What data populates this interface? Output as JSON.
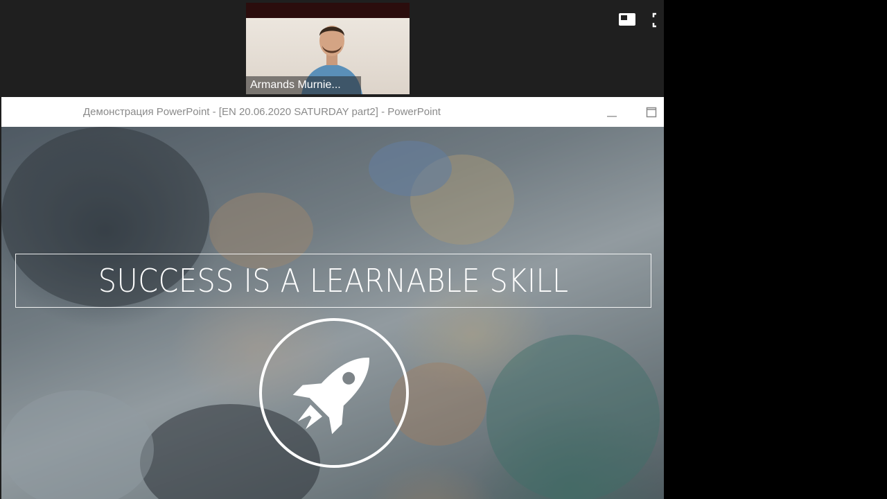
{
  "participant": {
    "name": "Armands Murnie..."
  },
  "window": {
    "title": "Демонстрация PowerPoint - [EN 20.06.2020 SATURDAY part2] - PowerPoint"
  },
  "slide": {
    "title": "SUCCESS IS A LEARNABLE SKILL",
    "emblem_icon": "rocket-icon"
  },
  "controls": {
    "layout_icon": "layout-icon",
    "fullscreen_icon": "fullscreen-icon",
    "minimize_icon": "minimize-icon",
    "maximize_icon": "maximize-icon"
  },
  "colors": {
    "titlebar_text": "#8a8a8a",
    "slide_text": "#ffffff"
  }
}
